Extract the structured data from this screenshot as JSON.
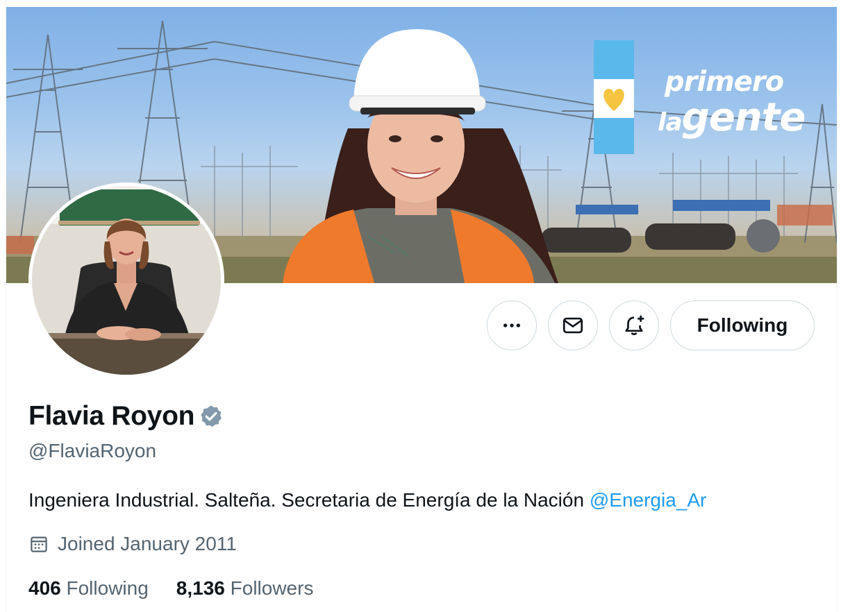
{
  "banner": {
    "brand_line1": "primero",
    "brand_line2a": "la",
    "brand_line2b": "gente",
    "flag_colors": {
      "sky": "#5ab8ea",
      "white": "#ffffff",
      "sun": "#f5c542"
    }
  },
  "profile": {
    "name": "Flavia Royon",
    "handle": "@FlaviaRoyon",
    "verified": true,
    "bio_text": "Ingeniera Industrial. Salteña. Secretaria de Energía de la Nación ",
    "bio_mention": "@Energia_Ar",
    "joined": "Joined January 2011"
  },
  "actions": {
    "more_icon": "ellipsis-icon",
    "message_icon": "envelope-icon",
    "notify_icon": "bell-plus-icon",
    "follow_label": "Following"
  },
  "stats": {
    "following_count": "406",
    "following_label": "Following",
    "followers_count": "8,136",
    "followers_label": "Followers"
  },
  "colors": {
    "accent": "#1d9bf0",
    "muted": "#536471",
    "verified": "#829aab"
  }
}
